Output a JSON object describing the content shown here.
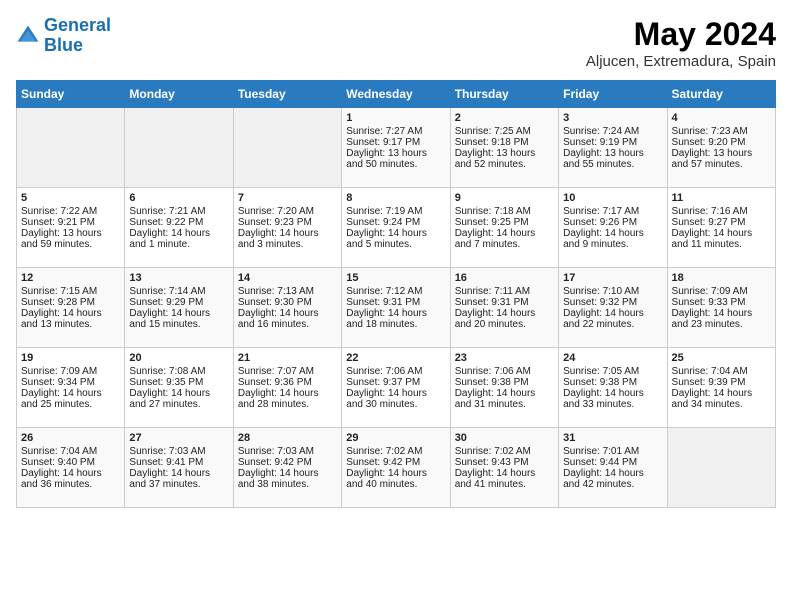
{
  "logo": {
    "line1": "General",
    "line2": "Blue"
  },
  "title": "May 2024",
  "location": "Aljucen, Extremadura, Spain",
  "days_of_week": [
    "Sunday",
    "Monday",
    "Tuesday",
    "Wednesday",
    "Thursday",
    "Friday",
    "Saturday"
  ],
  "weeks": [
    [
      {
        "day": "",
        "sunrise": "",
        "sunset": "",
        "daylight": ""
      },
      {
        "day": "",
        "sunrise": "",
        "sunset": "",
        "daylight": ""
      },
      {
        "day": "",
        "sunrise": "",
        "sunset": "",
        "daylight": ""
      },
      {
        "day": "1",
        "sunrise": "Sunrise: 7:27 AM",
        "sunset": "Sunset: 9:17 PM",
        "daylight": "Daylight: 13 hours and 50 minutes."
      },
      {
        "day": "2",
        "sunrise": "Sunrise: 7:25 AM",
        "sunset": "Sunset: 9:18 PM",
        "daylight": "Daylight: 13 hours and 52 minutes."
      },
      {
        "day": "3",
        "sunrise": "Sunrise: 7:24 AM",
        "sunset": "Sunset: 9:19 PM",
        "daylight": "Daylight: 13 hours and 55 minutes."
      },
      {
        "day": "4",
        "sunrise": "Sunrise: 7:23 AM",
        "sunset": "Sunset: 9:20 PM",
        "daylight": "Daylight: 13 hours and 57 minutes."
      }
    ],
    [
      {
        "day": "5",
        "sunrise": "Sunrise: 7:22 AM",
        "sunset": "Sunset: 9:21 PM",
        "daylight": "Daylight: 13 hours and 59 minutes."
      },
      {
        "day": "6",
        "sunrise": "Sunrise: 7:21 AM",
        "sunset": "Sunset: 9:22 PM",
        "daylight": "Daylight: 14 hours and 1 minute."
      },
      {
        "day": "7",
        "sunrise": "Sunrise: 7:20 AM",
        "sunset": "Sunset: 9:23 PM",
        "daylight": "Daylight: 14 hours and 3 minutes."
      },
      {
        "day": "8",
        "sunrise": "Sunrise: 7:19 AM",
        "sunset": "Sunset: 9:24 PM",
        "daylight": "Daylight: 14 hours and 5 minutes."
      },
      {
        "day": "9",
        "sunrise": "Sunrise: 7:18 AM",
        "sunset": "Sunset: 9:25 PM",
        "daylight": "Daylight: 14 hours and 7 minutes."
      },
      {
        "day": "10",
        "sunrise": "Sunrise: 7:17 AM",
        "sunset": "Sunset: 9:26 PM",
        "daylight": "Daylight: 14 hours and 9 minutes."
      },
      {
        "day": "11",
        "sunrise": "Sunrise: 7:16 AM",
        "sunset": "Sunset: 9:27 PM",
        "daylight": "Daylight: 14 hours and 11 minutes."
      }
    ],
    [
      {
        "day": "12",
        "sunrise": "Sunrise: 7:15 AM",
        "sunset": "Sunset: 9:28 PM",
        "daylight": "Daylight: 14 hours and 13 minutes."
      },
      {
        "day": "13",
        "sunrise": "Sunrise: 7:14 AM",
        "sunset": "Sunset: 9:29 PM",
        "daylight": "Daylight: 14 hours and 15 minutes."
      },
      {
        "day": "14",
        "sunrise": "Sunrise: 7:13 AM",
        "sunset": "Sunset: 9:30 PM",
        "daylight": "Daylight: 14 hours and 16 minutes."
      },
      {
        "day": "15",
        "sunrise": "Sunrise: 7:12 AM",
        "sunset": "Sunset: 9:31 PM",
        "daylight": "Daylight: 14 hours and 18 minutes."
      },
      {
        "day": "16",
        "sunrise": "Sunrise: 7:11 AM",
        "sunset": "Sunset: 9:31 PM",
        "daylight": "Daylight: 14 hours and 20 minutes."
      },
      {
        "day": "17",
        "sunrise": "Sunrise: 7:10 AM",
        "sunset": "Sunset: 9:32 PM",
        "daylight": "Daylight: 14 hours and 22 minutes."
      },
      {
        "day": "18",
        "sunrise": "Sunrise: 7:09 AM",
        "sunset": "Sunset: 9:33 PM",
        "daylight": "Daylight: 14 hours and 23 minutes."
      }
    ],
    [
      {
        "day": "19",
        "sunrise": "Sunrise: 7:09 AM",
        "sunset": "Sunset: 9:34 PM",
        "daylight": "Daylight: 14 hours and 25 minutes."
      },
      {
        "day": "20",
        "sunrise": "Sunrise: 7:08 AM",
        "sunset": "Sunset: 9:35 PM",
        "daylight": "Daylight: 14 hours and 27 minutes."
      },
      {
        "day": "21",
        "sunrise": "Sunrise: 7:07 AM",
        "sunset": "Sunset: 9:36 PM",
        "daylight": "Daylight: 14 hours and 28 minutes."
      },
      {
        "day": "22",
        "sunrise": "Sunrise: 7:06 AM",
        "sunset": "Sunset: 9:37 PM",
        "daylight": "Daylight: 14 hours and 30 minutes."
      },
      {
        "day": "23",
        "sunrise": "Sunrise: 7:06 AM",
        "sunset": "Sunset: 9:38 PM",
        "daylight": "Daylight: 14 hours and 31 minutes."
      },
      {
        "day": "24",
        "sunrise": "Sunrise: 7:05 AM",
        "sunset": "Sunset: 9:38 PM",
        "daylight": "Daylight: 14 hours and 33 minutes."
      },
      {
        "day": "25",
        "sunrise": "Sunrise: 7:04 AM",
        "sunset": "Sunset: 9:39 PM",
        "daylight": "Daylight: 14 hours and 34 minutes."
      }
    ],
    [
      {
        "day": "26",
        "sunrise": "Sunrise: 7:04 AM",
        "sunset": "Sunset: 9:40 PM",
        "daylight": "Daylight: 14 hours and 36 minutes."
      },
      {
        "day": "27",
        "sunrise": "Sunrise: 7:03 AM",
        "sunset": "Sunset: 9:41 PM",
        "daylight": "Daylight: 14 hours and 37 minutes."
      },
      {
        "day": "28",
        "sunrise": "Sunrise: 7:03 AM",
        "sunset": "Sunset: 9:42 PM",
        "daylight": "Daylight: 14 hours and 38 minutes."
      },
      {
        "day": "29",
        "sunrise": "Sunrise: 7:02 AM",
        "sunset": "Sunset: 9:42 PM",
        "daylight": "Daylight: 14 hours and 40 minutes."
      },
      {
        "day": "30",
        "sunrise": "Sunrise: 7:02 AM",
        "sunset": "Sunset: 9:43 PM",
        "daylight": "Daylight: 14 hours and 41 minutes."
      },
      {
        "day": "31",
        "sunrise": "Sunrise: 7:01 AM",
        "sunset": "Sunset: 9:44 PM",
        "daylight": "Daylight: 14 hours and 42 minutes."
      },
      {
        "day": "",
        "sunrise": "",
        "sunset": "",
        "daylight": ""
      }
    ]
  ]
}
